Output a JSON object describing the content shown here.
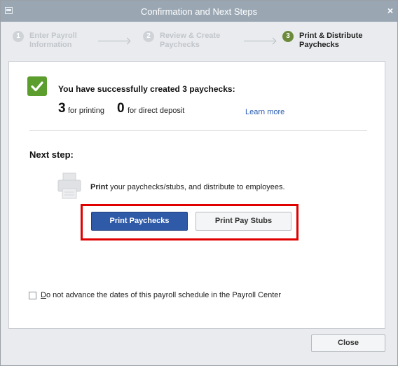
{
  "window": {
    "title": "Confirmation and Next Steps",
    "close_glyph": "×"
  },
  "steps": [
    {
      "number": "1",
      "label": "Enter Payroll Information",
      "state": "done"
    },
    {
      "number": "2",
      "label": "Review & Create Paychecks",
      "state": "done"
    },
    {
      "number": "3",
      "label": "Print & Distribute Paychecks",
      "state": "current"
    }
  ],
  "summary": {
    "icon": "check-icon",
    "message": "You have successfully created 3 paychecks:",
    "printing_count": "3",
    "printing_label": "for printing",
    "deposit_count": "0",
    "deposit_label": "for direct deposit",
    "learn_more": "Learn more"
  },
  "next_step": {
    "heading": "Next step:",
    "icon": "printer-icon",
    "desc_bold": "Print",
    "desc_rest": " your paychecks/stubs, and distribute to employees.",
    "print_paychecks_label": "Print Paychecks",
    "print_stubs_label": "Print Pay Stubs"
  },
  "option": {
    "checked": false,
    "label_underlined": "D",
    "label_rest": "o not advance the dates of this payroll schedule in the Payroll Center"
  },
  "footer": {
    "close_label": "Close"
  },
  "colors": {
    "titlebar": "#9aa7b3",
    "success_green": "#5c9e2e",
    "primary_blue": "#2e5aa8",
    "highlight_red": "#e00000",
    "link_blue": "#2a5db0"
  }
}
